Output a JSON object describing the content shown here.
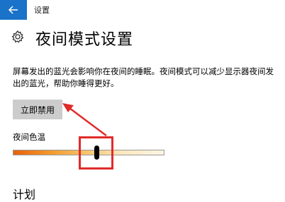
{
  "window": {
    "title": "设置"
  },
  "page": {
    "title": "夜间模式设置",
    "description": "屏幕发出的蓝光会影响你在夜间的睡眠。夜间模式可以减少显示器夜间发出的蓝光，帮助你睡得更好。"
  },
  "actions": {
    "disable_now_label": "立即禁用"
  },
  "color_temperature": {
    "label": "夜间色温",
    "level": 0.55,
    "gradient_colors": [
      "#e8610a",
      "#f29a2e",
      "#f7c770",
      "#fbe7bf",
      "#fdf5e2"
    ]
  },
  "schedule": {
    "title": "计划"
  },
  "annotation": {
    "color": "#e12b2b"
  },
  "icons": {
    "back": "back-arrow-icon",
    "settings": "gear-icon"
  },
  "colors": {
    "accent": "#1a73c8",
    "button_bg": "#cccccc"
  }
}
